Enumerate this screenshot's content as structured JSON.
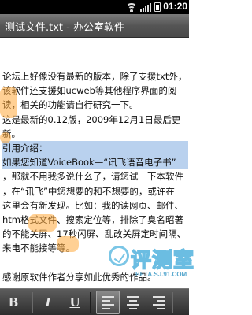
{
  "status_bar": {
    "time": "01:20"
  },
  "title_bar": {
    "title": "测试文件.txt - 办公室软件"
  },
  "document": {
    "lines": [
      {
        "text": "论坛上好像没有最新的版本，除了支援txt外，",
        "highlighted": false
      },
      {
        "text": "该软件还支援如ucweb等其他程序界面的阅",
        "highlighted": false
      },
      {
        "text": "读，相关的功能请自行研究一下。",
        "highlighted": false
      },
      {
        "text": "这是最新的0.12版，2009年12月1日最后更",
        "highlighted": false
      },
      {
        "text": "新。",
        "highlighted": false
      },
      {
        "text": "引用介绍：",
        "highlighted": true
      },
      {
        "text": "如果您知道VoiceBook—“讯飞语音电子书”",
        "highlighted": true
      },
      {
        "text": "，那就不用我多说什么了，请您试一下本软件",
        "highlighted": false
      },
      {
        "text": "，在“讯飞”中您想要的和不想要的，或许在",
        "highlighted": false
      },
      {
        "text": "这里会有新发现。比如：我的读网页、邮件、",
        "highlighted": false
      },
      {
        "text": "htm格式文件、搜索定位等，排除了臭名昭著",
        "highlighted": false
      },
      {
        "text": "的不能关屏、17秒闪屏、乱改关屏定时间隔、",
        "highlighted": false
      },
      {
        "text": "来电不能接等等。",
        "highlighted": false
      },
      {
        "text": "",
        "highlighted": false
      },
      {
        "text": "感谢原软件作者分享如此优秀的作品。",
        "highlighted": false
      }
    ]
  },
  "watermark": {
    "text": "评测室",
    "url": "BETA.SJ.91.COM"
  },
  "toolbar": {
    "bold_label": "B",
    "italic_label": "I",
    "underline_label": "U",
    "active_align": "align-left"
  },
  "colors": {
    "highlight": "#b9d1ee",
    "title_bar": "#555555",
    "toolbar": "#3a3a3a",
    "watermark": "#6bbde2"
  }
}
